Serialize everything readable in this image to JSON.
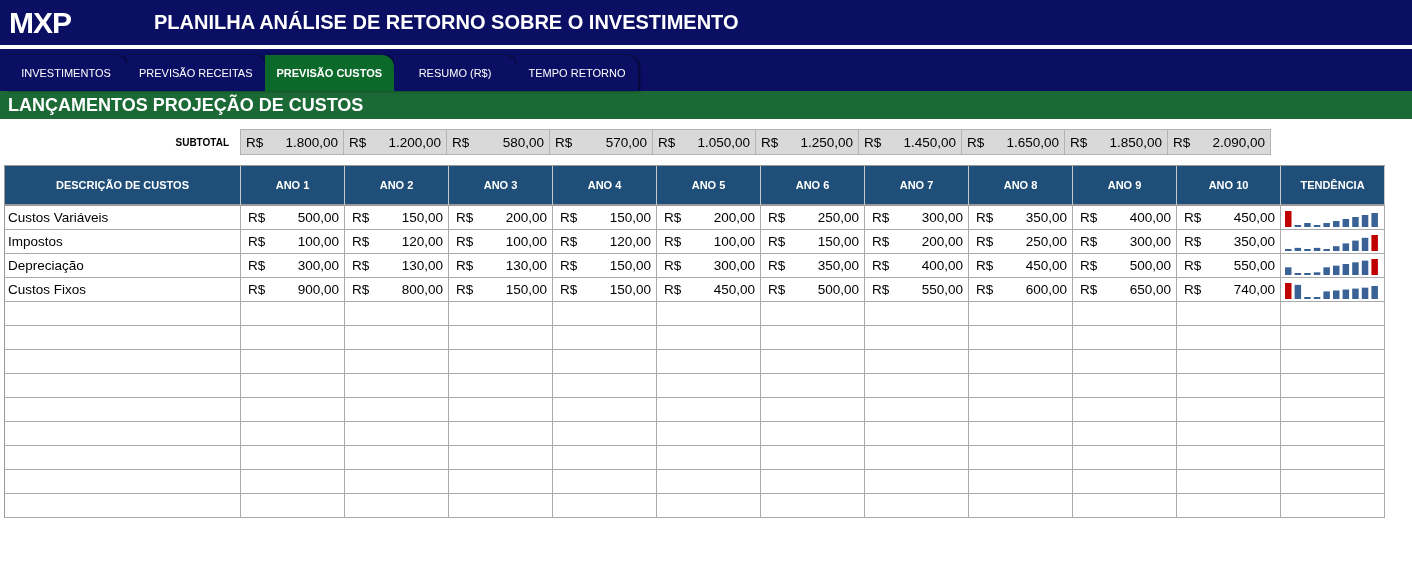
{
  "header": {
    "logo": "MXP",
    "title": "PLANILHA ANÁLISE DE RETORNO SOBRE O INVESTIMENTO"
  },
  "tabs": [
    {
      "label": "INVESTIMENTOS",
      "selected": false
    },
    {
      "label": "PREVISÃO RECEITAS",
      "selected": false
    },
    {
      "label": "PREVISÃO CUSTOS",
      "selected": true
    },
    {
      "label": "RESUMO (R$)",
      "selected": false
    },
    {
      "label": "TEMPO RETORNO",
      "selected": false
    }
  ],
  "section_title": "LANÇAMENTOS PROJEÇÃO DE CUSTOS",
  "subtotal": {
    "label": "SUBTOTAL",
    "values": [
      {
        "currency": "R$",
        "amount": "1.800,00"
      },
      {
        "currency": "R$",
        "amount": "1.200,00"
      },
      {
        "currency": "R$",
        "amount": "580,00"
      },
      {
        "currency": "R$",
        "amount": "570,00"
      },
      {
        "currency": "R$",
        "amount": "1.050,00"
      },
      {
        "currency": "R$",
        "amount": "1.250,00"
      },
      {
        "currency": "R$",
        "amount": "1.450,00"
      },
      {
        "currency": "R$",
        "amount": "1.650,00"
      },
      {
        "currency": "R$",
        "amount": "1.850,00"
      },
      {
        "currency": "R$",
        "amount": "2.090,00"
      }
    ]
  },
  "table": {
    "columns": [
      "DESCRIÇÃO DE CUSTOS",
      "ANO 1",
      "ANO 2",
      "ANO 3",
      "ANO 4",
      "ANO 5",
      "ANO 6",
      "ANO 7",
      "ANO 8",
      "ANO 9",
      "ANO 10",
      "TENDÊNCIA"
    ],
    "rows": [
      {
        "description": "Custos Variáveis",
        "values": [
          {
            "currency": "R$",
            "amount": "500,00"
          },
          {
            "currency": "R$",
            "amount": "150,00"
          },
          {
            "currency": "R$",
            "amount": "200,00"
          },
          {
            "currency": "R$",
            "amount": "150,00"
          },
          {
            "currency": "R$",
            "amount": "200,00"
          },
          {
            "currency": "R$",
            "amount": "250,00"
          },
          {
            "currency": "R$",
            "amount": "300,00"
          },
          {
            "currency": "R$",
            "amount": "350,00"
          },
          {
            "currency": "R$",
            "amount": "400,00"
          },
          {
            "currency": "R$",
            "amount": "450,00"
          }
        ]
      },
      {
        "description": "Impostos",
        "values": [
          {
            "currency": "R$",
            "amount": "100,00"
          },
          {
            "currency": "R$",
            "amount": "120,00"
          },
          {
            "currency": "R$",
            "amount": "100,00"
          },
          {
            "currency": "R$",
            "amount": "120,00"
          },
          {
            "currency": "R$",
            "amount": "100,00"
          },
          {
            "currency": "R$",
            "amount": "150,00"
          },
          {
            "currency": "R$",
            "amount": "200,00"
          },
          {
            "currency": "R$",
            "amount": "250,00"
          },
          {
            "currency": "R$",
            "amount": "300,00"
          },
          {
            "currency": "R$",
            "amount": "350,00"
          }
        ]
      },
      {
        "description": "Depreciação",
        "values": [
          {
            "currency": "R$",
            "amount": "300,00"
          },
          {
            "currency": "R$",
            "amount": "130,00"
          },
          {
            "currency": "R$",
            "amount": "130,00"
          },
          {
            "currency": "R$",
            "amount": "150,00"
          },
          {
            "currency": "R$",
            "amount": "300,00"
          },
          {
            "currency": "R$",
            "amount": "350,00"
          },
          {
            "currency": "R$",
            "amount": "400,00"
          },
          {
            "currency": "R$",
            "amount": "450,00"
          },
          {
            "currency": "R$",
            "amount": "500,00"
          },
          {
            "currency": "R$",
            "amount": "550,00"
          }
        ]
      },
      {
        "description": "Custos Fixos",
        "values": [
          {
            "currency": "R$",
            "amount": "900,00"
          },
          {
            "currency": "R$",
            "amount": "800,00"
          },
          {
            "currency": "R$",
            "amount": "150,00"
          },
          {
            "currency": "R$",
            "amount": "150,00"
          },
          {
            "currency": "R$",
            "amount": "450,00"
          },
          {
            "currency": "R$",
            "amount": "500,00"
          },
          {
            "currency": "R$",
            "amount": "550,00"
          },
          {
            "currency": "R$",
            "amount": "600,00"
          },
          {
            "currency": "R$",
            "amount": "650,00"
          },
          {
            "currency": "R$",
            "amount": "740,00"
          }
        ]
      }
    ]
  }
}
